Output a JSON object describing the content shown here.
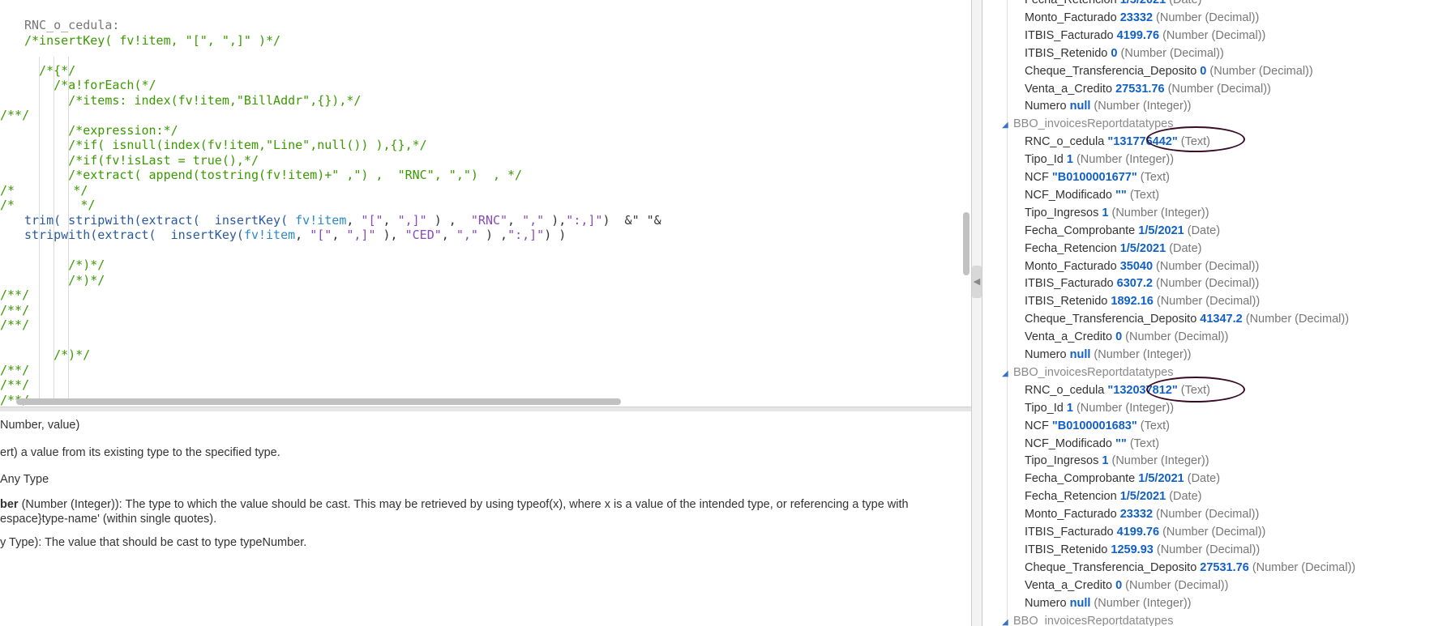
{
  "code_lines": [
    [
      [
        "c-id",
        "RNC_o_cedula:"
      ]
    ],
    [
      [
        "c-cm",
        "/*insertKey( fv!item, \"[\", \",]\" )*/"
      ]
    ],
    [],
    [
      [
        "c-cm",
        "  /*{*/"
      ]
    ],
    [
      [
        "c-cm",
        "    /*a!forEach(*/"
      ]
    ],
    [
      [
        "c-cm",
        "      /*items: index(fv!item,\"BillAddr\",{}),*/"
      ]
    ],
    [
      [
        "c-cm",
        "/**/"
      ]
    ],
    [
      [
        "c-cm",
        "      /*expression:*/"
      ]
    ],
    [
      [
        "c-cm",
        "      /*if( isnull(index(fv!item,\"Line\",null()) ),{},*/"
      ]
    ],
    [
      [
        "c-cm",
        "      /*if(fv!isLast = true(),*/"
      ]
    ],
    [
      [
        "c-cm",
        "      /*extract( append(tostring(fv!item)+\" ,\") ,  \"RNC\", \",\")  , */"
      ]
    ],
    [
      [
        "c-cm",
        "/*        */"
      ]
    ],
    [
      [
        "c-cm",
        "/*         */"
      ]
    ],
    [
      [
        "c-fn",
        "trim( stripwith(extract(  insertKey( "
      ],
      [
        "c-var",
        "fv!item"
      ],
      [
        "c-op",
        ", "
      ],
      [
        "c-str",
        "\"[\""
      ],
      [
        "c-op",
        ", "
      ],
      [
        "c-str",
        "\",]\""
      ],
      [
        "c-op",
        " ) ,  "
      ],
      [
        "c-str",
        "\"RNC\""
      ],
      [
        "c-op",
        ", "
      ],
      [
        "c-str",
        "\",\""
      ],
      [
        "c-op",
        " ),"
      ],
      [
        "c-str",
        "\":,]\""
      ],
      [
        "c-op",
        ")  &\" \"&"
      ]
    ],
    [
      [
        "c-fn",
        "stripwith(extract(  insertKey("
      ],
      [
        "c-var",
        "fv!item"
      ],
      [
        "c-op",
        ", "
      ],
      [
        "c-str",
        "\"[\""
      ],
      [
        "c-op",
        ", "
      ],
      [
        "c-str",
        "\",]\""
      ],
      [
        "c-op",
        " ), "
      ],
      [
        "c-str",
        "\"CED\""
      ],
      [
        "c-op",
        ", "
      ],
      [
        "c-str",
        "\",\""
      ],
      [
        "c-op",
        " ) ,"
      ],
      [
        "c-str",
        "\":,]\""
      ],
      [
        "c-op",
        ") )"
      ]
    ],
    [],
    [
      [
        "c-cm",
        "      /*)*/"
      ]
    ],
    [
      [
        "c-cm",
        "      /*)*/"
      ]
    ],
    [
      [
        "c-cm",
        "/**/"
      ]
    ],
    [
      [
        "c-cm",
        "/**/"
      ]
    ],
    [
      [
        "c-cm",
        "/**/"
      ]
    ],
    [],
    [
      [
        "c-cm",
        "    /*)*/"
      ]
    ],
    [
      [
        "c-cm",
        "/**/"
      ]
    ],
    [
      [
        "c-cm",
        "/**/"
      ]
    ],
    [
      [
        "c-cm",
        "/**/"
      ]
    ],
    [
      [
        "c-cm",
        "  /*}*/"
      ]
    ]
  ],
  "docs": {
    "signature": "Number, value)",
    "description": "ert) a value from its existing type to the specified type.",
    "returns": "Any Type",
    "param1_name": "ber",
    "param1_desc": " (Number (Integer)): The type to which the value should be cast. This may be retrieved by using typeof(x), where x is a value of the intended type, or referencing a type with",
    "param1_cont": "espace}type-name' (within single quotes).",
    "param2": "y Type): The value that should be cast to type typeNumber."
  },
  "tree": {
    "top_partial": [
      {
        "key": "Fecha_Retencion",
        "value": "1/5/2021",
        "type": "(Date)"
      },
      {
        "key": "Monto_Facturado",
        "value": "23332",
        "type": "(Number (Decimal))"
      },
      {
        "key": "ITBIS_Facturado",
        "value": "4199.76",
        "type": "(Number (Decimal))"
      },
      {
        "key": "ITBIS_Retenido",
        "value": "0",
        "type": "(Number (Decimal))"
      },
      {
        "key": "Cheque_Transferencia_Deposito",
        "value": "0",
        "type": "(Number (Decimal))"
      },
      {
        "key": "Venta_a_Credito",
        "value": "27531.76",
        "type": "(Number (Decimal))"
      },
      {
        "key": "Numero",
        "value": "null",
        "type": "(Number (Integer))"
      }
    ],
    "group_label": "BBO_invoicesReportdatatypes",
    "group1": [
      {
        "key": "RNC_o_cedula",
        "value": "\"131776442\"",
        "type": "(Text)"
      },
      {
        "key": "Tipo_Id",
        "value": "1",
        "type": "(Number (Integer))"
      },
      {
        "key": "NCF",
        "value": "\"B0100001677\"",
        "type": "(Text)"
      },
      {
        "key": "NCF_Modificado",
        "value": "\"\"",
        "type": "(Text)"
      },
      {
        "key": "Tipo_Ingresos",
        "value": "1",
        "type": "(Number (Integer))"
      },
      {
        "key": "Fecha_Comprobante",
        "value": "1/5/2021",
        "type": "(Date)"
      },
      {
        "key": "Fecha_Retencion",
        "value": "1/5/2021",
        "type": "(Date)"
      },
      {
        "key": "Monto_Facturado",
        "value": "35040",
        "type": "(Number (Decimal))"
      },
      {
        "key": "ITBIS_Facturado",
        "value": "6307.2",
        "type": "(Number (Decimal))"
      },
      {
        "key": "ITBIS_Retenido",
        "value": "1892.16",
        "type": "(Number (Decimal))"
      },
      {
        "key": "Cheque_Transferencia_Deposito",
        "value": "41347.2",
        "type": "(Number (Decimal))"
      },
      {
        "key": "Venta_a_Credito",
        "value": "0",
        "type": "(Number (Decimal))"
      },
      {
        "key": "Numero",
        "value": "null",
        "type": "(Number (Integer))"
      }
    ],
    "group2": [
      {
        "key": "RNC_o_cedula",
        "value": "\"132037812\"",
        "type": "(Text)"
      },
      {
        "key": "Tipo_Id",
        "value": "1",
        "type": "(Number (Integer))"
      },
      {
        "key": "NCF",
        "value": "\"B0100001683\"",
        "type": "(Text)"
      },
      {
        "key": "NCF_Modificado",
        "value": "\"\"",
        "type": "(Text)"
      },
      {
        "key": "Tipo_Ingresos",
        "value": "1",
        "type": "(Number (Integer))"
      },
      {
        "key": "Fecha_Comprobante",
        "value": "1/5/2021",
        "type": "(Date)"
      },
      {
        "key": "Fecha_Retencion",
        "value": "1/5/2021",
        "type": "(Date)"
      },
      {
        "key": "Monto_Facturado",
        "value": "23332",
        "type": "(Number (Decimal))"
      },
      {
        "key": "ITBIS_Facturado",
        "value": "4199.76",
        "type": "(Number (Decimal))"
      },
      {
        "key": "ITBIS_Retenido",
        "value": "1259.93",
        "type": "(Number (Decimal))"
      },
      {
        "key": "Cheque_Transferencia_Deposito",
        "value": "27531.76",
        "type": "(Number (Decimal))"
      },
      {
        "key": "Venta_a_Credito",
        "value": "0",
        "type": "(Number (Decimal))"
      },
      {
        "key": "Numero",
        "value": "null",
        "type": "(Number (Integer))"
      }
    ]
  }
}
